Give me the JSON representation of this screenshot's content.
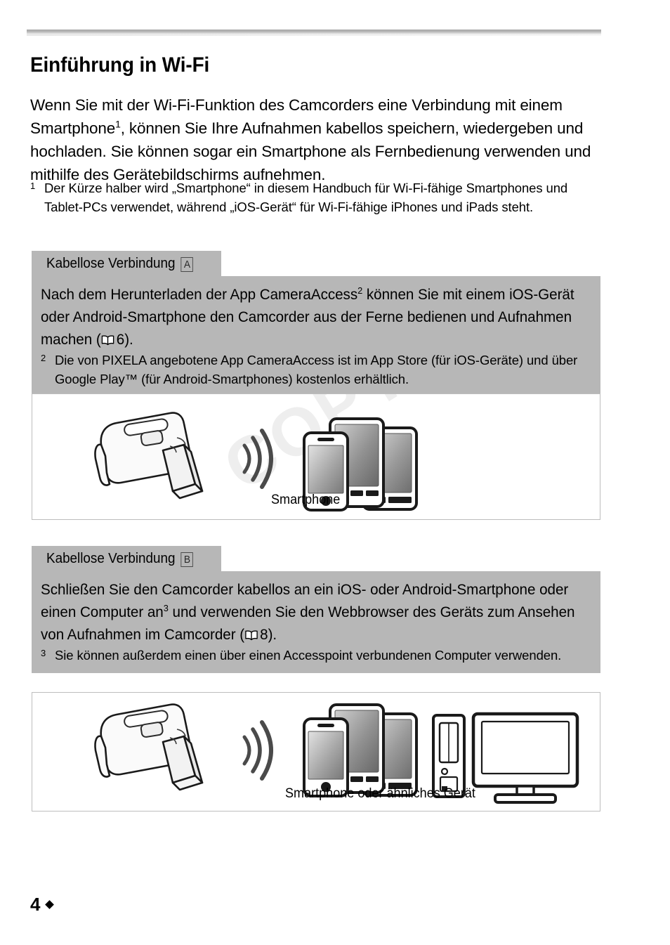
{
  "document": {
    "title": "Einführung in Wi-Fi",
    "page_number": "4"
  },
  "intro": {
    "paragraph_part1": "Wenn Sie mit der Wi-Fi-Funktion des Camcorders eine Verbindung mit einem Smartphone",
    "footnote_ref": "1",
    "paragraph_part2": ", können Sie Ihre Aufnahmen kabellos speichern, wiedergeben und hochladen. Sie können sogar ein Smartphone als Fernbedienung verwenden und mithilfe des Gerätebildschirms aufnehmen.",
    "footnote_mark": "1",
    "footnote_text": "Der Kürze halber wird „Smartphone“ in diesem Handbuch für Wi-Fi-fähige Smartphones und Tablet-PCs verwendet, während „iOS-Gerät“ für Wi-Fi-fähige iPhones und iPads steht."
  },
  "sections": [
    {
      "tab_label": "Kabellose Verbindung",
      "tag": "A",
      "body_part1": "Nach dem Herunterladen der App CameraAccess",
      "body_ref": "2",
      "body_part2": " können Sie mit einem iOS-Gerät oder Android-Smartphone den Camcorder aus der Ferne bedienen und Aufnahmen machen (",
      "body_page_ref": "6",
      "body_part3": ").",
      "footnote_mark": "2",
      "footnote_text": "Die von PIXELA angebotene App CameraAccess ist im App Store (für iOS-Geräte) und über Google Play™ (für Android-Smartphones) kostenlos erhältlich.",
      "caption": "Smartphone",
      "watermark": "COPY"
    },
    {
      "tab_label": "Kabellose Verbindung",
      "tag": "B",
      "body_part1": "Schließen Sie den Camcorder kabellos an ein iOS- oder Android-Smartphone oder einen Computer an",
      "body_ref": "3",
      "body_part2": " und verwenden Sie den Webbrowser des Geräts zum Ansehen von Aufnahmen im Camcorder (",
      "body_page_ref": "8",
      "body_part3": ").",
      "footnote_mark": "3",
      "footnote_text": "Sie können außerdem einen über einen Accesspoint verbundenen Computer verwenden.",
      "caption": "Smartphone oder ähnliches Gerät",
      "watermark": ""
    }
  ],
  "colors": {
    "gray_block": "#b7b7b7",
    "panel_border": "#bdbdbd",
    "watermark": "#eeeeee",
    "wave": "#4a4a4a"
  }
}
